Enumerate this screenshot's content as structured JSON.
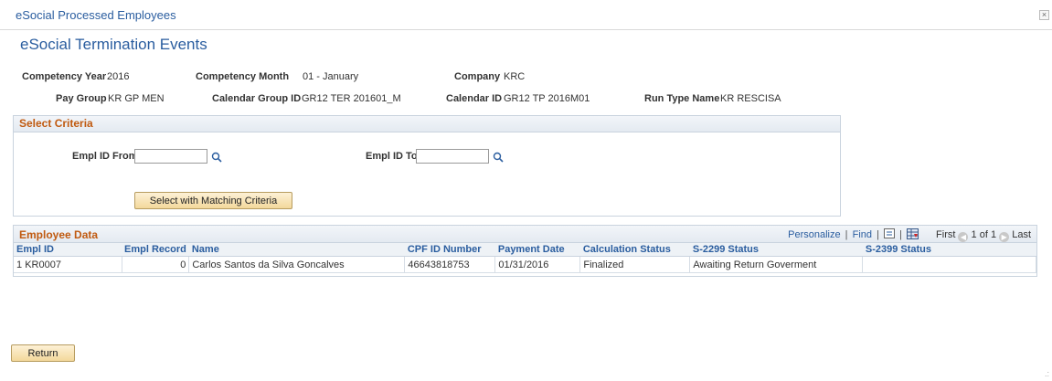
{
  "window": {
    "title": "eSocial Processed Employees",
    "close_label": "×"
  },
  "page": {
    "title": "eSocial Termination Events"
  },
  "fields": {
    "competency_year": {
      "label": "Competency Year",
      "value": "2016"
    },
    "competency_month": {
      "label": "Competency Month",
      "value": "01 - January"
    },
    "company": {
      "label": "Company",
      "value": "KRC"
    },
    "pay_group": {
      "label": "Pay Group",
      "value": "KR GP MEN"
    },
    "calendar_group_id": {
      "label": "Calendar Group ID",
      "value": "GR12 TER 201601_M"
    },
    "calendar_id": {
      "label": "Calendar ID",
      "value": "GR12 TP 2016M01"
    },
    "run_type_name": {
      "label": "Run Type Name",
      "value": "KR RESCISA"
    }
  },
  "criteria": {
    "title": "Select Criteria",
    "empl_id_from": {
      "label": "Empl ID From",
      "value": "",
      "placeholder": ""
    },
    "empl_id_to": {
      "label": "Empl ID To",
      "value": "",
      "placeholder": ""
    },
    "select_button": "Select with Matching Criteria"
  },
  "grid": {
    "title": "Employee Data",
    "personalize": "Personalize",
    "find": "Find",
    "sep": "|",
    "first": "First",
    "range": "1 of 1",
    "last": "Last",
    "columns": [
      "Empl ID",
      "Empl Record",
      "Name",
      "CPF ID Number",
      "Payment Date",
      "Calculation Status",
      "S-2299 Status",
      "S-2399 Status"
    ],
    "rows": [
      {
        "row_num": "1",
        "empl_id": "KR0007",
        "empl_record": "0",
        "name": "Carlos Santos da Silva Goncalves",
        "cpf": "46643818753",
        "payment_date": "01/31/2016",
        "calc_status": "Finalized",
        "s2299": "Awaiting Return Goverment",
        "s2399": ""
      }
    ]
  },
  "return_button": "Return"
}
